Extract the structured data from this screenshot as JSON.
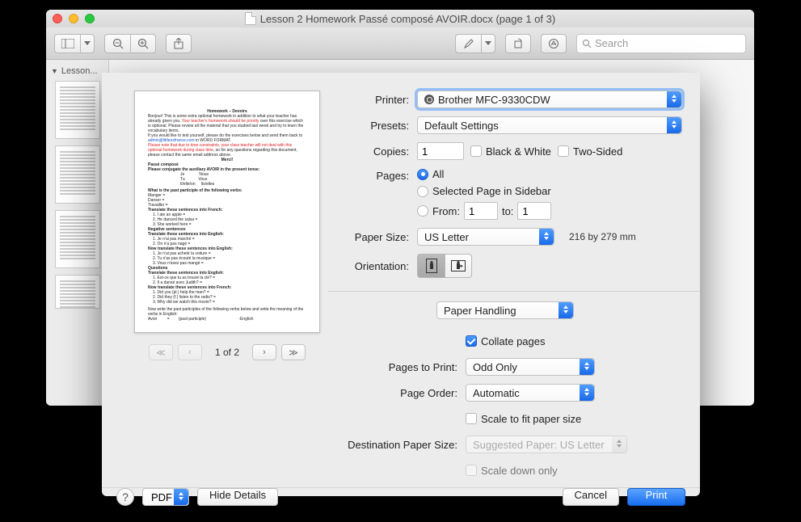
{
  "window": {
    "title": "Lesson 2 Homework Passé composé AVOIR.docx (page 1 of 3)",
    "sidebar_label": "Lesson...",
    "search_placeholder": "Search"
  },
  "dialog": {
    "labels": {
      "printer": "Printer:",
      "presets": "Presets:",
      "copies": "Copies:",
      "bw": "Black & White",
      "twosided": "Two-Sided",
      "pages": "Pages:",
      "all": "All",
      "selected_in_sidebar": "Selected Page in Sidebar",
      "from": "From:",
      "to": "to:",
      "paper_size": "Paper Size:",
      "paper_dim": "216 by 279 mm",
      "orientation": "Orientation:",
      "section": "Paper Handling",
      "collate": "Collate pages",
      "pages_to_print": "Pages to Print:",
      "page_order": "Page Order:",
      "scale_fit": "Scale to fit paper size",
      "dest_paper": "Destination Paper Size:",
      "scale_down": "Scale down only"
    },
    "values": {
      "printer": "Brother MFC-9330CDW",
      "presets": "Default Settings",
      "copies": "1",
      "from": "1",
      "to": "1",
      "paper_size": "US Letter",
      "pages_to_print": "Odd Only",
      "page_order": "Automatic",
      "dest_paper": "Suggested Paper: US Letter"
    },
    "pager": {
      "label": "1 of 2"
    },
    "buttons": {
      "help": "?",
      "pdf": "PDF",
      "hide_details": "Hide Details",
      "cancel": "Cancel",
      "print": "Print"
    }
  }
}
